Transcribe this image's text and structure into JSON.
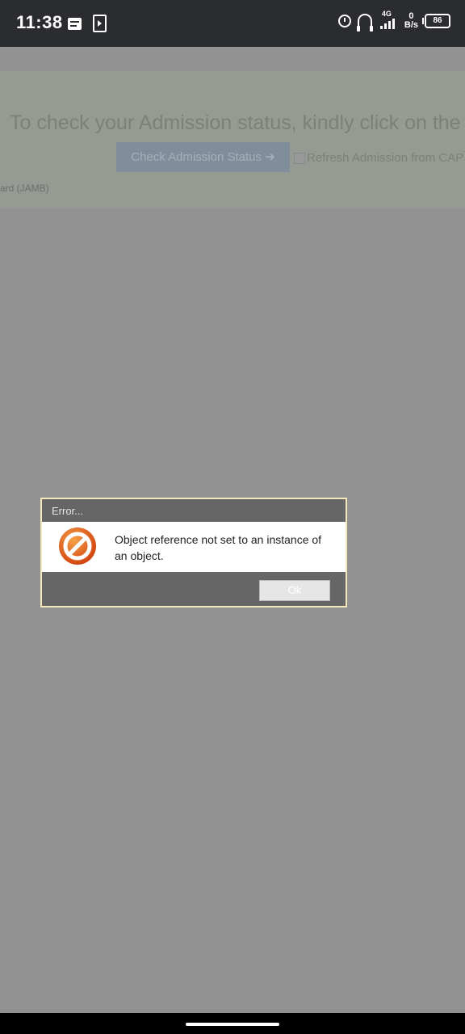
{
  "status_bar": {
    "time": "11:38",
    "network": "4G",
    "speed_value": "0",
    "speed_unit": "B/s",
    "battery": "86",
    "icons": [
      "message-icon",
      "play-icon",
      "alarm-icon",
      "headphone-icon",
      "signal-icon",
      "battery-icon"
    ]
  },
  "page": {
    "banner_text": "To check your Admission status, kindly click on the b",
    "check_button": "Check Admission Status",
    "refresh_label": "Refresh Admission from CAP",
    "board_text": "ard (JAMB)"
  },
  "dialog": {
    "title": "Error...",
    "message": "Object reference not set to an instance of an object.",
    "ok_label": "Ok",
    "icon": "stop-icon"
  }
}
